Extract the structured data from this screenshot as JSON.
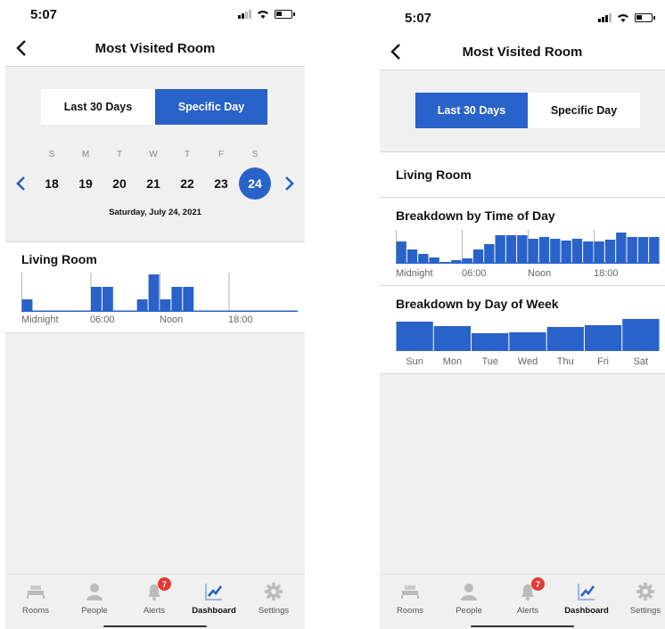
{
  "colors": {
    "accent": "#2962c9",
    "badge": "#e53935",
    "panel": "#f0f0f0"
  },
  "status_bar": {
    "time": "5:07"
  },
  "nav": {
    "title": "Most Visited Room"
  },
  "tabs": [
    {
      "label": "Rooms",
      "icon": "bed-icon"
    },
    {
      "label": "People",
      "icon": "person-icon"
    },
    {
      "label": "Alerts",
      "icon": "bell-icon",
      "badge": "7"
    },
    {
      "label": "Dashboard",
      "icon": "chart-icon"
    },
    {
      "label": "Settings",
      "icon": "gear-icon"
    }
  ],
  "left_screen": {
    "segment": {
      "options": [
        "Last 30 Days",
        "Specific Day"
      ],
      "selected": "Specific Day"
    },
    "week": {
      "day_letters": [
        "S",
        "M",
        "T",
        "W",
        "T",
        "F",
        "S"
      ],
      "dates": [
        "18",
        "19",
        "20",
        "21",
        "22",
        "23",
        "24"
      ],
      "selected": "24",
      "caption": "Saturday, July 24, 2021"
    },
    "room_title": "Living Room",
    "chart_data": {
      "type": "bar",
      "title": "Living Room",
      "categories": [
        "0",
        "1",
        "2",
        "3",
        "4",
        "5",
        "6",
        "7",
        "8",
        "9",
        "10",
        "11",
        "12",
        "13",
        "14",
        "15",
        "16",
        "17",
        "18",
        "19",
        "20",
        "21",
        "22",
        "23"
      ],
      "values": [
        0.5,
        0,
        0,
        0,
        0,
        0,
        1,
        1,
        0,
        0,
        0.5,
        1.5,
        0.5,
        1,
        1,
        0,
        0,
        0,
        0,
        0,
        0,
        0,
        0,
        0
      ],
      "tick_labels": [
        "Midnight",
        "06:00",
        "Noon",
        "18:00"
      ],
      "ylim": [
        0,
        1.5
      ]
    }
  },
  "right_screen": {
    "segment": {
      "options": [
        "Last 30 Days",
        "Specific Day"
      ],
      "selected": "Last 30 Days"
    },
    "room_title": "Living Room",
    "chart_data": [
      {
        "type": "bar",
        "title": "Breakdown by Time of Day",
        "categories": [
          "0",
          "1",
          "2",
          "3",
          "4",
          "5",
          "6",
          "7",
          "8",
          "9",
          "10",
          "11",
          "12",
          "13",
          "14",
          "15",
          "16",
          "17",
          "18",
          "19",
          "20",
          "21",
          "22",
          "23"
        ],
        "values": [
          25,
          16,
          11,
          7,
          2,
          4,
          6,
          16,
          22,
          32,
          32,
          32,
          28,
          30,
          28,
          26,
          28,
          25,
          25,
          27,
          35,
          30,
          30,
          30
        ],
        "tick_labels": [
          "Midnight",
          "06:00",
          "Noon",
          "18:00"
        ],
        "ylim": [
          0,
          36
        ]
      },
      {
        "type": "bar",
        "title": "Breakdown by Day of Week",
        "categories": [
          "Sun",
          "Mon",
          "Tue",
          "Wed",
          "Thu",
          "Fri",
          "Sat"
        ],
        "values": [
          33,
          28,
          20,
          21,
          27,
          29,
          36
        ],
        "ylim": [
          0,
          36
        ]
      }
    ]
  }
}
